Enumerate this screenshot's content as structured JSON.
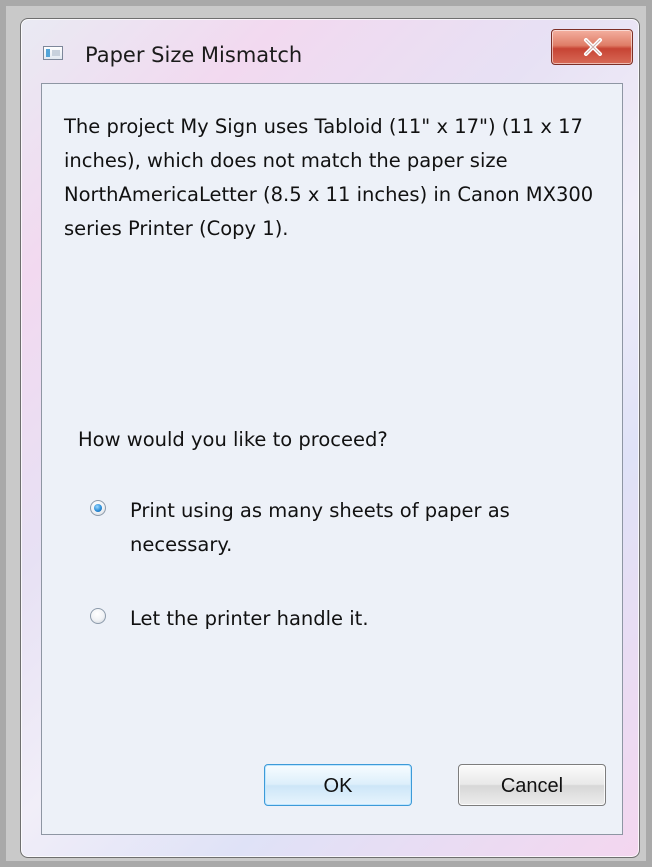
{
  "window": {
    "title": "Paper Size Mismatch"
  },
  "dialog": {
    "message": "The project My Sign uses Tabloid (11\" x 17\") (11 x 17 inches), which does not match the paper size NorthAmericaLetter (8.5 x 11 inches) in Canon MX300 series Printer (Copy 1).",
    "question": "How would you like to proceed?",
    "options": [
      {
        "label": "Print using as many sheets of paper as necessary.",
        "selected": true
      },
      {
        "label": "Let the printer handle it.",
        "selected": false
      }
    ]
  },
  "buttons": {
    "ok": "OK",
    "cancel": "Cancel"
  },
  "icons": {
    "app": "dialog-icon",
    "close": "close-icon"
  },
  "colors": {
    "accent": "#3d9ad8",
    "close": "#c74434",
    "dialog_background": "#edf1f8"
  }
}
